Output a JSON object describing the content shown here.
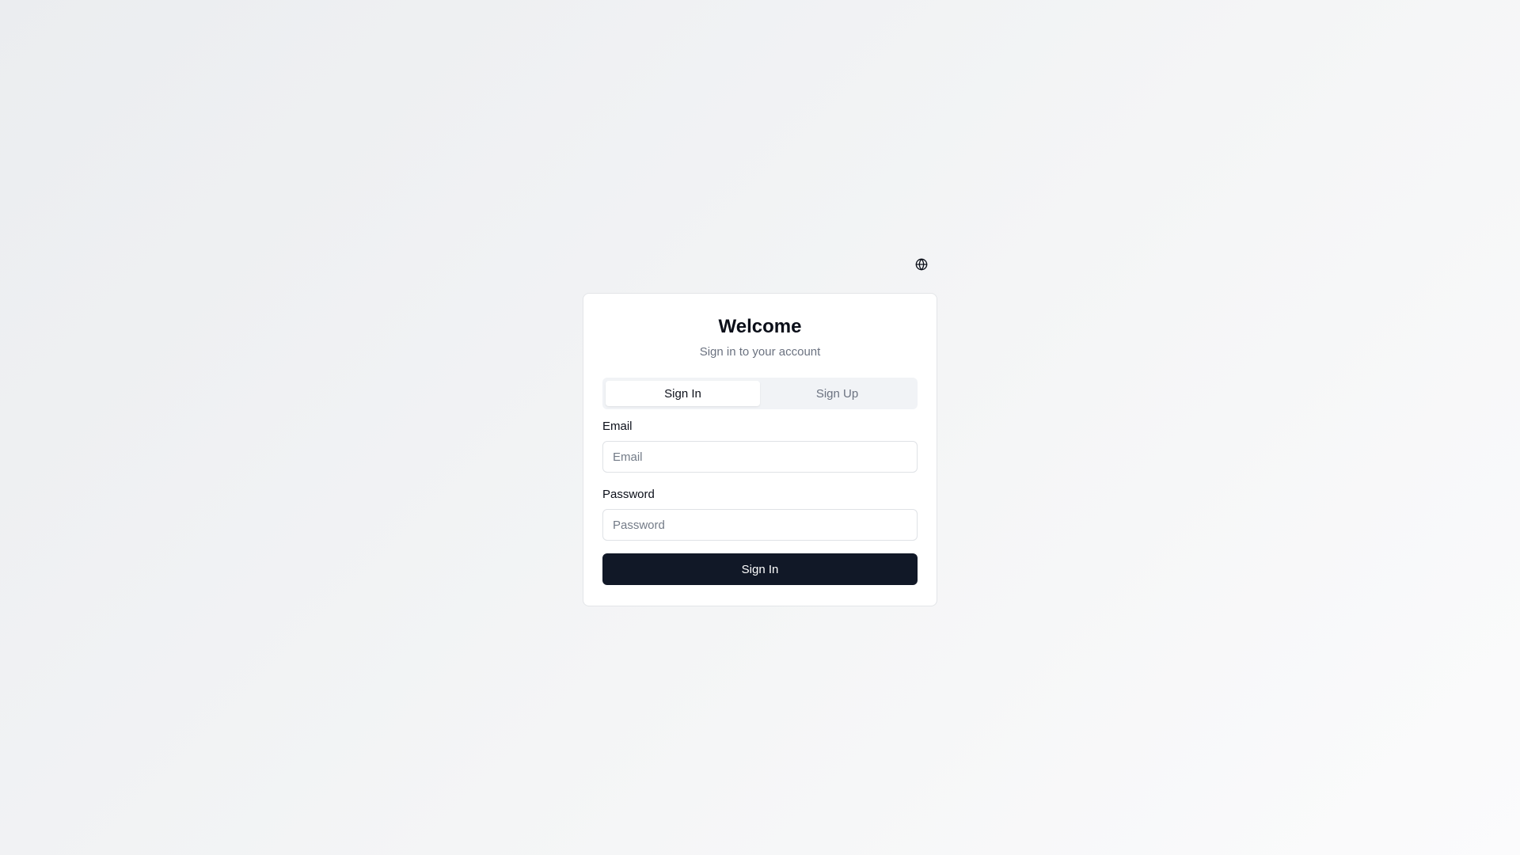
{
  "header": {
    "language_icon": "globe-icon"
  },
  "card": {
    "title": "Welcome",
    "subtitle": "Sign in to your account"
  },
  "tabs": [
    {
      "label": "Sign In",
      "active": true
    },
    {
      "label": "Sign Up",
      "active": false
    }
  ],
  "form": {
    "email": {
      "label": "Email",
      "placeholder": "Email",
      "value": ""
    },
    "password": {
      "label": "Password",
      "placeholder": "Password",
      "value": ""
    },
    "submit_label": "Sign In"
  },
  "colors": {
    "primary_button": "#111827",
    "muted_text": "#6b7280",
    "tab_track": "#f1f3f6"
  }
}
